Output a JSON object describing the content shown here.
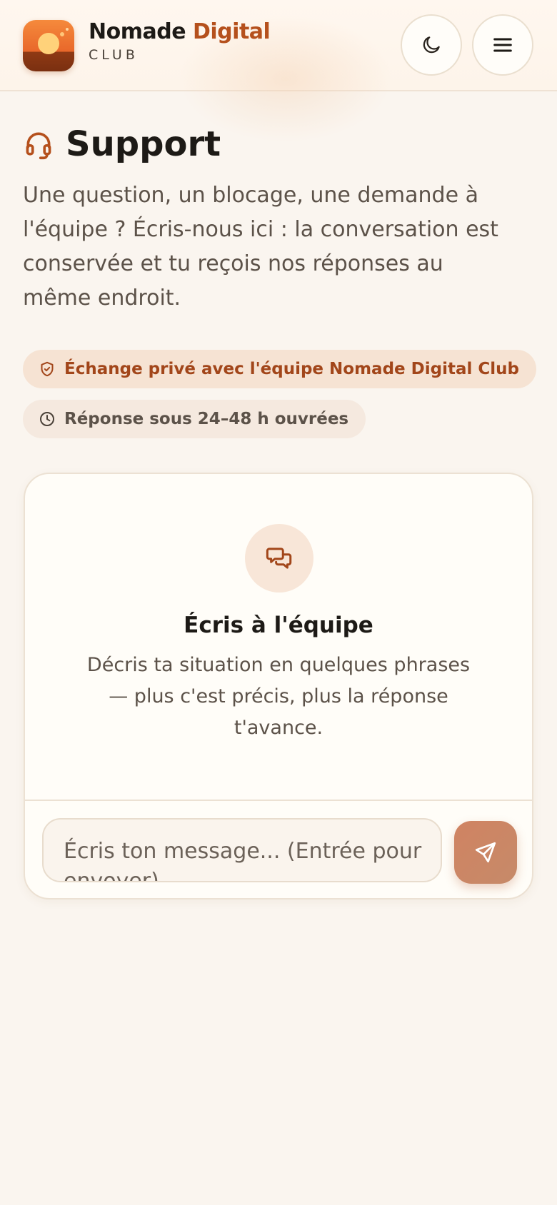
{
  "header": {
    "brand_name_primary": "Nomade",
    "brand_name_accent": "Digital",
    "brand_sub": "CLUB",
    "theme_icon": "moon-icon",
    "menu_icon": "menu-icon"
  },
  "page": {
    "title": "Support",
    "title_icon": "headset-icon",
    "intro": "Une question, un blocage, une demande à l'équipe ? Écris-nous ici : la conversation est conservée et tu reçois nos réponses au même endroit."
  },
  "badges": [
    {
      "label": "Échange privé avec l'équipe Nomade Digital Club",
      "icon": "shield-check-icon"
    },
    {
      "label": "Réponse sous 24–48 h ouvrées",
      "icon": "clock-icon"
    }
  ],
  "chat": {
    "empty_icon": "chat-bubbles-icon",
    "empty_title": "Écris à l'équipe",
    "empty_text": "Décris ta situation en quelques phrases — plus c'est précis, plus la réponse t'avance.",
    "input_placeholder": "Écris ton message... (Entrée pour envoyer)",
    "input_value": "",
    "send_icon": "send-icon"
  },
  "colors": {
    "accent": "#b5501c",
    "background": "#faf5ef",
    "card": "#fffdf8",
    "send_button": "#cd8665"
  }
}
